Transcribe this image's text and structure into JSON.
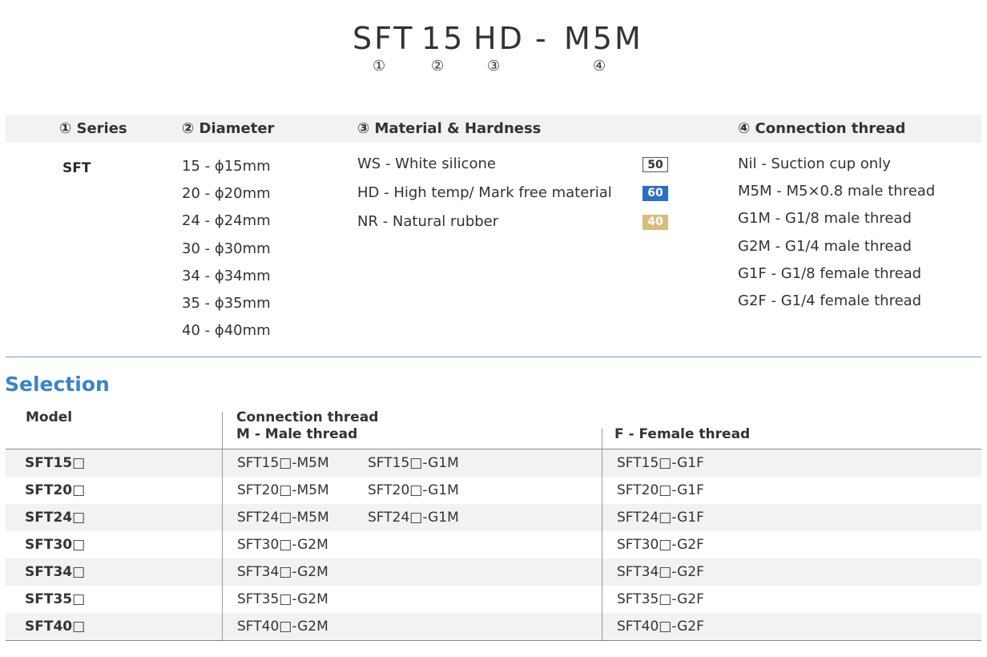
{
  "code": {
    "parts": [
      "SFT",
      "15",
      "HD",
      "-",
      "M5M"
    ],
    "numbers": [
      "①",
      "②",
      "③",
      "④"
    ]
  },
  "legend": {
    "series": {
      "header": "① Series",
      "value": "SFT"
    },
    "diameter": {
      "header": "② Diameter",
      "items": [
        "15 - ϕ15mm",
        "20 - ϕ20mm",
        "24 - ϕ24mm",
        "30 - ϕ30mm",
        "34 - ϕ34mm",
        "35 - ϕ35mm",
        "40 - ϕ40mm"
      ]
    },
    "material": {
      "header": "③  Material & Hardness",
      "items": [
        {
          "label": "WS - White silicone",
          "hardness": "50"
        },
        {
          "label": "HD - High temp/ Mark free material",
          "hardness": "60"
        },
        {
          "label": "NR -  Natural rubber",
          "hardness": "40"
        }
      ],
      "colors": {
        "hd": "#2e6fc0",
        "nr": "#d8bd7c"
      }
    },
    "connection": {
      "header": "④  Connection thread",
      "items": [
        "Nil  -  Suction cup only",
        "M5M - M5×0.8 male thread",
        "G1M  - G1/8 male thread",
        "G2M  - G1/4 male thread",
        "G1F   - G1/8 female thread",
        "G2F   - G1/4 female thread"
      ]
    }
  },
  "selection": {
    "title": "Selection",
    "accent_color": "#3a84c4",
    "headers": {
      "model": "Model",
      "connection": "Connection thread",
      "male": "M - Male thread",
      "female": "F - Female thread"
    },
    "rows": [
      {
        "model": "SFT15□",
        "m1": "SFT15□-M5M",
        "m2": "SFT15□-G1M",
        "f": "SFT15□-G1F"
      },
      {
        "model": "SFT20□",
        "m1": "SFT20□-M5M",
        "m2": "SFT20□-G1M",
        "f": "SFT20□-G1F"
      },
      {
        "model": "SFT24□",
        "m1": "SFT24□-M5M",
        "m2": "SFT24□-G1M",
        "f": "SFT24□-G1F"
      },
      {
        "model": "SFT30□",
        "m1": "SFT30□-G2M",
        "m2": "",
        "f": "SFT30□-G2F"
      },
      {
        "model": "SFT34□",
        "m1": "SFT34□-G2M",
        "m2": "",
        "f": "SFT34□-G2F"
      },
      {
        "model": "SFT35□",
        "m1": "SFT35□-G2M",
        "m2": "",
        "f": "SFT35□-G2F"
      },
      {
        "model": "SFT40□",
        "m1": "SFT40□-G2M",
        "m2": "",
        "f": "SFT40□-G2F"
      }
    ]
  }
}
